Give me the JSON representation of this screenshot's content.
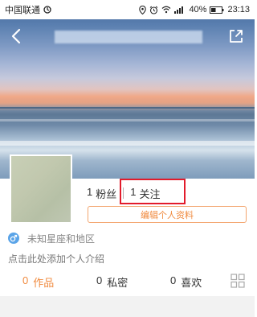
{
  "status_bar": {
    "carrier": "中国联通",
    "battery": "40%",
    "time": "23:13"
  },
  "header": {
    "back_icon": "back-arrow-icon",
    "share_icon": "share-icon"
  },
  "profile": {
    "fans_count": "1",
    "fans_label": "粉丝",
    "follow_count": "1",
    "follow_label": "关注",
    "edit_label": "编辑个人资料",
    "zodiac_text": "未知星座和地区",
    "bio_hint": "点击此处添加个人介绍",
    "gender_icon": "male-icon"
  },
  "tabs": [
    {
      "count": "0",
      "label": "作品"
    },
    {
      "count": "0",
      "label": "私密"
    },
    {
      "count": "0",
      "label": "喜欢"
    }
  ],
  "colors": {
    "accent": "#f08a3e",
    "highlight": "#e21b2b",
    "gender": "#5aa4e8"
  }
}
